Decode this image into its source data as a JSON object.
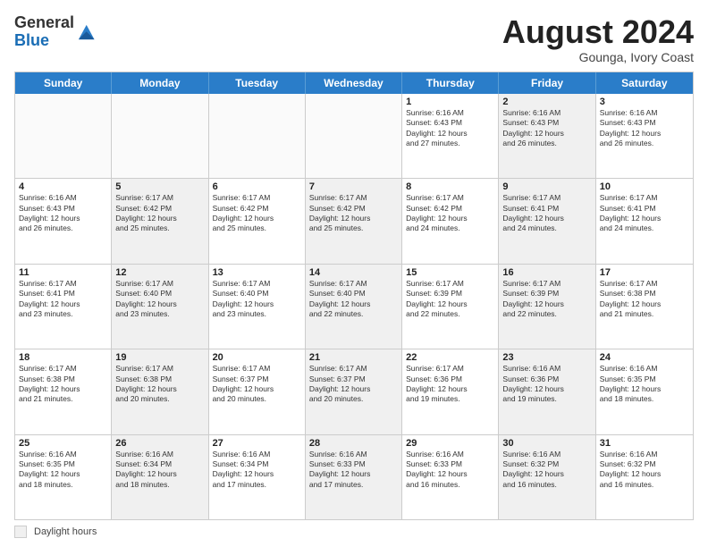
{
  "logo": {
    "line1": "General",
    "line2": "Blue"
  },
  "title": "August 2024",
  "location": "Gounga, Ivory Coast",
  "days_of_week": [
    "Sunday",
    "Monday",
    "Tuesday",
    "Wednesday",
    "Thursday",
    "Friday",
    "Saturday"
  ],
  "footer_label": "Daylight hours",
  "weeks": [
    [
      {
        "day": "",
        "info": "",
        "shaded": false,
        "empty": true
      },
      {
        "day": "",
        "info": "",
        "shaded": false,
        "empty": true
      },
      {
        "day": "",
        "info": "",
        "shaded": false,
        "empty": true
      },
      {
        "day": "",
        "info": "",
        "shaded": false,
        "empty": true
      },
      {
        "day": "1",
        "info": "Sunrise: 6:16 AM\nSunset: 6:43 PM\nDaylight: 12 hours\nand 27 minutes.",
        "shaded": false,
        "empty": false
      },
      {
        "day": "2",
        "info": "Sunrise: 6:16 AM\nSunset: 6:43 PM\nDaylight: 12 hours\nand 26 minutes.",
        "shaded": true,
        "empty": false
      },
      {
        "day": "3",
        "info": "Sunrise: 6:16 AM\nSunset: 6:43 PM\nDaylight: 12 hours\nand 26 minutes.",
        "shaded": false,
        "empty": false
      }
    ],
    [
      {
        "day": "4",
        "info": "Sunrise: 6:16 AM\nSunset: 6:43 PM\nDaylight: 12 hours\nand 26 minutes.",
        "shaded": false,
        "empty": false
      },
      {
        "day": "5",
        "info": "Sunrise: 6:17 AM\nSunset: 6:42 PM\nDaylight: 12 hours\nand 25 minutes.",
        "shaded": true,
        "empty": false
      },
      {
        "day": "6",
        "info": "Sunrise: 6:17 AM\nSunset: 6:42 PM\nDaylight: 12 hours\nand 25 minutes.",
        "shaded": false,
        "empty": false
      },
      {
        "day": "7",
        "info": "Sunrise: 6:17 AM\nSunset: 6:42 PM\nDaylight: 12 hours\nand 25 minutes.",
        "shaded": true,
        "empty": false
      },
      {
        "day": "8",
        "info": "Sunrise: 6:17 AM\nSunset: 6:42 PM\nDaylight: 12 hours\nand 24 minutes.",
        "shaded": false,
        "empty": false
      },
      {
        "day": "9",
        "info": "Sunrise: 6:17 AM\nSunset: 6:41 PM\nDaylight: 12 hours\nand 24 minutes.",
        "shaded": true,
        "empty": false
      },
      {
        "day": "10",
        "info": "Sunrise: 6:17 AM\nSunset: 6:41 PM\nDaylight: 12 hours\nand 24 minutes.",
        "shaded": false,
        "empty": false
      }
    ],
    [
      {
        "day": "11",
        "info": "Sunrise: 6:17 AM\nSunset: 6:41 PM\nDaylight: 12 hours\nand 23 minutes.",
        "shaded": false,
        "empty": false
      },
      {
        "day": "12",
        "info": "Sunrise: 6:17 AM\nSunset: 6:40 PM\nDaylight: 12 hours\nand 23 minutes.",
        "shaded": true,
        "empty": false
      },
      {
        "day": "13",
        "info": "Sunrise: 6:17 AM\nSunset: 6:40 PM\nDaylight: 12 hours\nand 23 minutes.",
        "shaded": false,
        "empty": false
      },
      {
        "day": "14",
        "info": "Sunrise: 6:17 AM\nSunset: 6:40 PM\nDaylight: 12 hours\nand 22 minutes.",
        "shaded": true,
        "empty": false
      },
      {
        "day": "15",
        "info": "Sunrise: 6:17 AM\nSunset: 6:39 PM\nDaylight: 12 hours\nand 22 minutes.",
        "shaded": false,
        "empty": false
      },
      {
        "day": "16",
        "info": "Sunrise: 6:17 AM\nSunset: 6:39 PM\nDaylight: 12 hours\nand 22 minutes.",
        "shaded": true,
        "empty": false
      },
      {
        "day": "17",
        "info": "Sunrise: 6:17 AM\nSunset: 6:38 PM\nDaylight: 12 hours\nand 21 minutes.",
        "shaded": false,
        "empty": false
      }
    ],
    [
      {
        "day": "18",
        "info": "Sunrise: 6:17 AM\nSunset: 6:38 PM\nDaylight: 12 hours\nand 21 minutes.",
        "shaded": false,
        "empty": false
      },
      {
        "day": "19",
        "info": "Sunrise: 6:17 AM\nSunset: 6:38 PM\nDaylight: 12 hours\nand 20 minutes.",
        "shaded": true,
        "empty": false
      },
      {
        "day": "20",
        "info": "Sunrise: 6:17 AM\nSunset: 6:37 PM\nDaylight: 12 hours\nand 20 minutes.",
        "shaded": false,
        "empty": false
      },
      {
        "day": "21",
        "info": "Sunrise: 6:17 AM\nSunset: 6:37 PM\nDaylight: 12 hours\nand 20 minutes.",
        "shaded": true,
        "empty": false
      },
      {
        "day": "22",
        "info": "Sunrise: 6:17 AM\nSunset: 6:36 PM\nDaylight: 12 hours\nand 19 minutes.",
        "shaded": false,
        "empty": false
      },
      {
        "day": "23",
        "info": "Sunrise: 6:16 AM\nSunset: 6:36 PM\nDaylight: 12 hours\nand 19 minutes.",
        "shaded": true,
        "empty": false
      },
      {
        "day": "24",
        "info": "Sunrise: 6:16 AM\nSunset: 6:35 PM\nDaylight: 12 hours\nand 18 minutes.",
        "shaded": false,
        "empty": false
      }
    ],
    [
      {
        "day": "25",
        "info": "Sunrise: 6:16 AM\nSunset: 6:35 PM\nDaylight: 12 hours\nand 18 minutes.",
        "shaded": false,
        "empty": false
      },
      {
        "day": "26",
        "info": "Sunrise: 6:16 AM\nSunset: 6:34 PM\nDaylight: 12 hours\nand 18 minutes.",
        "shaded": true,
        "empty": false
      },
      {
        "day": "27",
        "info": "Sunrise: 6:16 AM\nSunset: 6:34 PM\nDaylight: 12 hours\nand 17 minutes.",
        "shaded": false,
        "empty": false
      },
      {
        "day": "28",
        "info": "Sunrise: 6:16 AM\nSunset: 6:33 PM\nDaylight: 12 hours\nand 17 minutes.",
        "shaded": true,
        "empty": false
      },
      {
        "day": "29",
        "info": "Sunrise: 6:16 AM\nSunset: 6:33 PM\nDaylight: 12 hours\nand 16 minutes.",
        "shaded": false,
        "empty": false
      },
      {
        "day": "30",
        "info": "Sunrise: 6:16 AM\nSunset: 6:32 PM\nDaylight: 12 hours\nand 16 minutes.",
        "shaded": true,
        "empty": false
      },
      {
        "day": "31",
        "info": "Sunrise: 6:16 AM\nSunset: 6:32 PM\nDaylight: 12 hours\nand 16 minutes.",
        "shaded": false,
        "empty": false
      }
    ]
  ]
}
